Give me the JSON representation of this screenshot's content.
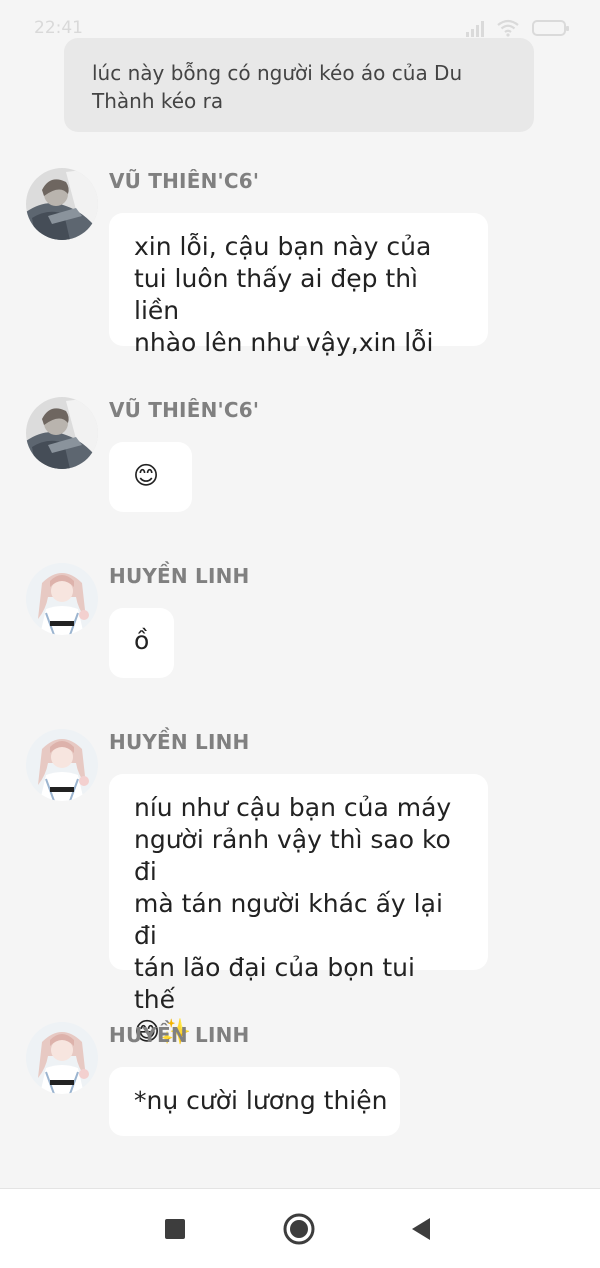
{
  "status_bar": {
    "time": "22:41",
    "color": "#d9d9d9"
  },
  "narration": {
    "text": "lúc này bỗng có người kéo áo của Du Thành kéo ra"
  },
  "messages": [
    {
      "sender": "VŨ THIÊN'C6'",
      "avatar": "avatar-vu-thien",
      "lines": [
        "xin lỗi, cậu bạn này của",
        "tui luôn thấy ai đẹp thì liền",
        "nhào lên như vậy,xin lỗi"
      ]
    },
    {
      "sender": "VŨ THIÊN'C6'",
      "avatar": "avatar-vu-thien",
      "lines": [
        "😊"
      ]
    },
    {
      "sender": "HUYỀN LINH",
      "avatar": "avatar-huyen-linh",
      "lines": [
        "ồ"
      ]
    },
    {
      "sender": "HUYỀN LINH",
      "avatar": "avatar-huyen-linh",
      "lines": [
        "níu như cậu bạn của máy",
        "người rảnh vậy thì sao ko đi",
        "mà tán người khác ấy lại đi",
        "tán lão đại của bọn tui thế",
        "😄✨"
      ]
    },
    {
      "sender": "HUYỀN LINH",
      "avatar": "avatar-huyen-linh",
      "lines": [
        "*nụ cười lương thiện"
      ]
    }
  ],
  "nav_bar": {
    "icons": [
      "square-recents-icon",
      "circle-home-icon",
      "triangle-back-icon"
    ],
    "icon_color": "#3d3d3d"
  }
}
